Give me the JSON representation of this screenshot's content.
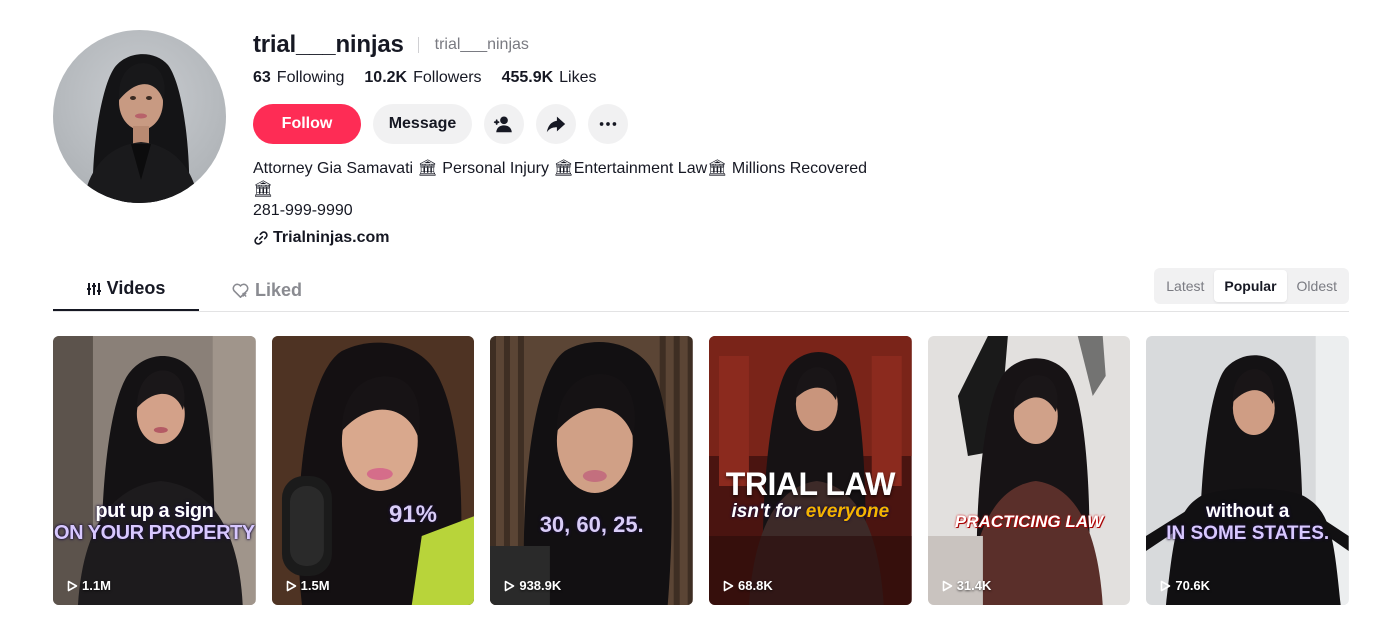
{
  "profile": {
    "username": "trial___ninjas",
    "nickname": "trial___ninjas",
    "following_count": "63",
    "following_label": "Following",
    "followers_count": "10.2K",
    "followers_label": "Followers",
    "likes_count": "455.9K",
    "likes_label": "Likes",
    "bio": "Attorney Gia Samavati 🏛 Personal Injury 🏛Entertainment Law🏛 Millions Recovered\n🏛\n281-999-9990",
    "link": "Trialninjas.com"
  },
  "actions": {
    "follow_label": "Follow",
    "message_label": "Message"
  },
  "tabs": {
    "videos_label": "Videos",
    "liked_label": "Liked"
  },
  "sort": {
    "latest": "Latest",
    "popular": "Popular",
    "oldest": "Oldest",
    "selected": "Popular"
  },
  "videos": [
    {
      "views": "1.1M",
      "caption_line1": "put up a sign",
      "caption_line2": "ON YOUR PROPERTY"
    },
    {
      "views": "1.5M",
      "caption_line1": "91%"
    },
    {
      "views": "938.9K",
      "caption_line1": "30, 60, 25."
    },
    {
      "views": "68.8K",
      "caption_line1": "TRIAL LAW",
      "caption_line2_prefix": "isn't for",
      "caption_line2_accent": "everyone"
    },
    {
      "views": "31.4K",
      "caption_line1": "PRACTICING LAW"
    },
    {
      "views": "70.6K",
      "caption_line1": "without a",
      "caption_line2": "IN SOME STATES."
    }
  ],
  "colors": {
    "follow_button": "#fe2c55",
    "text_primary": "#161823",
    "text_secondary": "#7a7b82",
    "button_gray": "#f1f1f2"
  },
  "icons": [
    "add-friend-icon",
    "share-icon",
    "more-icon",
    "link-icon",
    "videos-grid-icon",
    "liked-heart-icon",
    "play-icon"
  ]
}
